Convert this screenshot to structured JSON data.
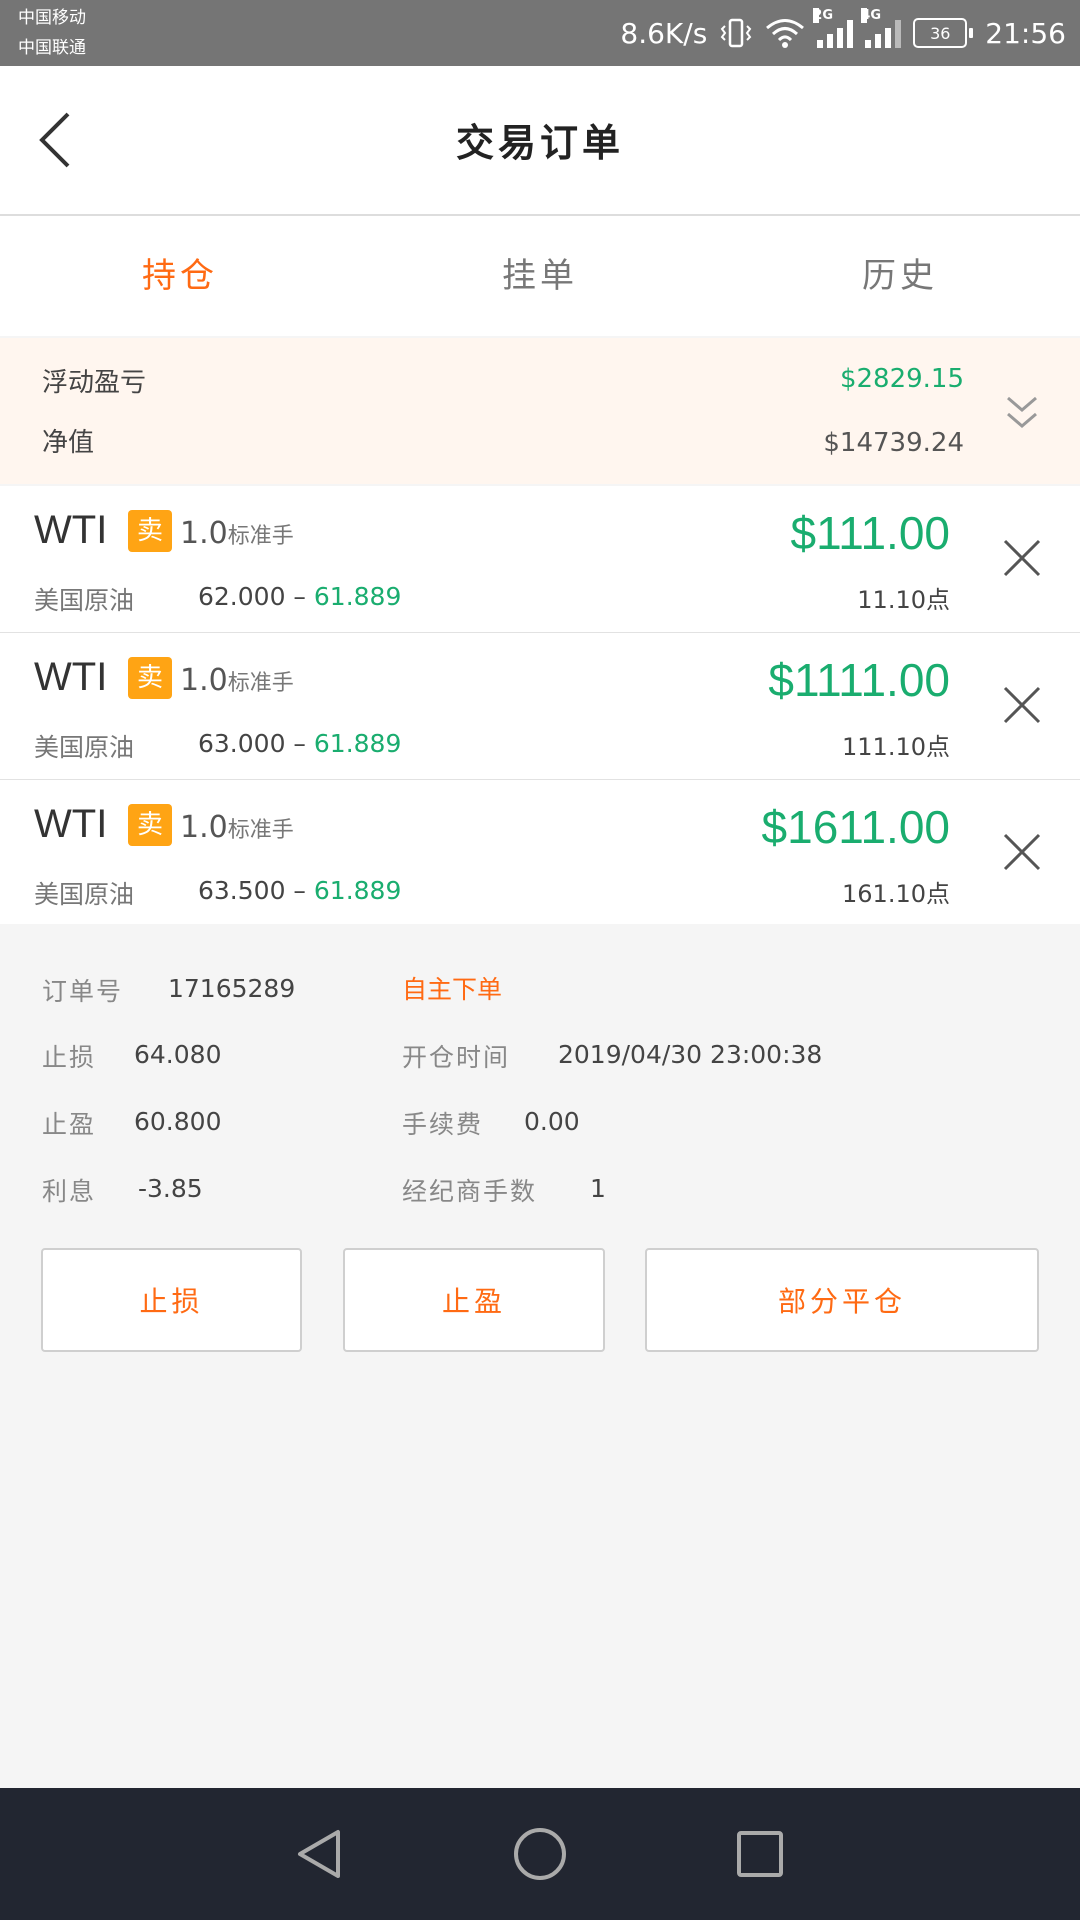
{
  "status_bar": {
    "carrier1": "中国移动",
    "carrier2": "中国联通",
    "speed": "8.6K/s",
    "signal1_tag": "2G",
    "signal2_tag": "4G",
    "battery": "36",
    "time": "21:56"
  },
  "header": {
    "title": "交易订单"
  },
  "tabs": [
    {
      "label": "持仓",
      "active": true
    },
    {
      "label": "挂单",
      "active": false
    },
    {
      "label": "历史",
      "active": false
    }
  ],
  "summary": {
    "floating_pnl_label": "浮动盈亏",
    "floating_pnl_value": "$2829.15",
    "equity_label": "净值",
    "equity_value": "$14739.24"
  },
  "orders": [
    {
      "symbol": "WTI",
      "side": "卖",
      "lots": "1.0",
      "lot_unit": "标准手",
      "name": "美国原油",
      "open_price": "62.000",
      "separator": " – ",
      "current_price": "61.889",
      "pnl": "$111.00",
      "points": "11.10点"
    },
    {
      "symbol": "WTI",
      "side": "卖",
      "lots": "1.0",
      "lot_unit": "标准手",
      "name": "美国原油",
      "open_price": "63.000",
      "separator": " – ",
      "current_price": "61.889",
      "pnl": "$1111.00",
      "points": "111.10点"
    },
    {
      "symbol": "WTI",
      "side": "卖",
      "lots": "1.0",
      "lot_unit": "标准手",
      "name": "美国原油",
      "open_price": "63.500",
      "separator": " – ",
      "current_price": "61.889",
      "pnl": "$1611.00",
      "points": "161.10点"
    }
  ],
  "details": {
    "order_no_label": "订单号",
    "order_no": "17165289",
    "order_type": "自主下单",
    "stop_loss_label": "止损",
    "stop_loss": "64.080",
    "open_time_label": "开仓时间",
    "open_time": "2019/04/30 23:00:38",
    "take_profit_label": "止盈",
    "take_profit": "60.800",
    "fee_label": "手续费",
    "fee": "0.00",
    "interest_label": "利息",
    "interest": "-3.85",
    "broker_lots_label": "经纪商手数",
    "broker_lots": "1"
  },
  "buttons": {
    "stop_loss": "止损",
    "take_profit": "止盈",
    "partial_close": "部分平仓"
  },
  "colors": {
    "accent": "#ff6a13",
    "profit": "#1aad6f",
    "sell_badge": "#ffa414"
  },
  "icons": [
    "back-icon",
    "chevron-double-down-icon",
    "close-icon",
    "nav-back-icon",
    "nav-home-icon",
    "nav-recents-icon"
  ]
}
